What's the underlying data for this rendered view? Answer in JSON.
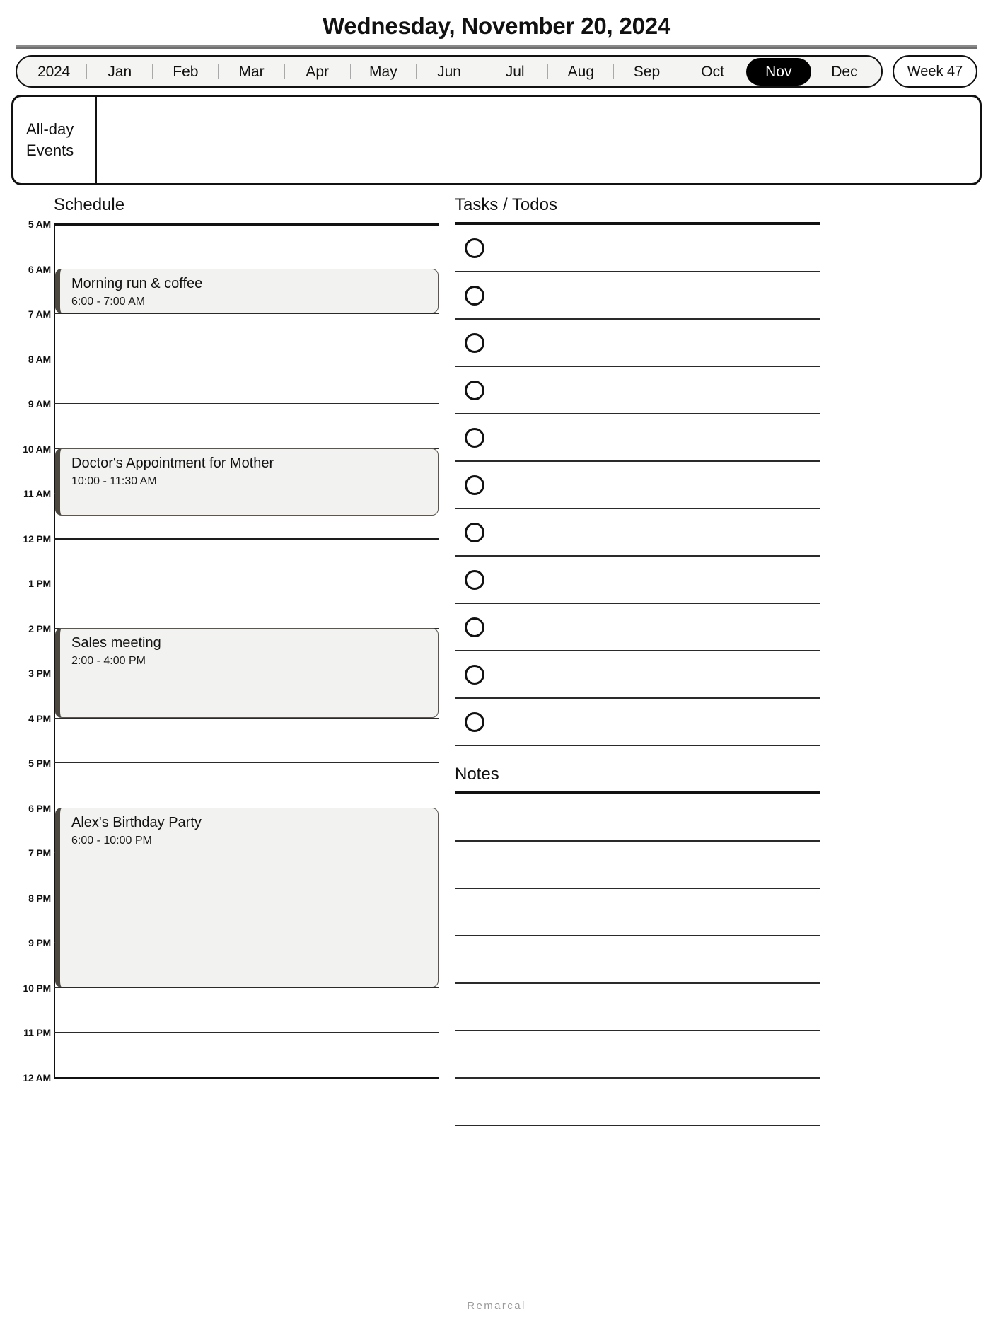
{
  "header": {
    "title": "Wednesday, November 20, 2024"
  },
  "monthbar": {
    "year": "2024",
    "months": [
      "Jan",
      "Feb",
      "Mar",
      "Apr",
      "May",
      "Jun",
      "Jul",
      "Aug",
      "Sep",
      "Oct",
      "Nov",
      "Dec"
    ],
    "active_month": "Nov",
    "week_label": "Week 47"
  },
  "allday": {
    "label": "All-day\nEvents",
    "label_line1": "All-day",
    "label_line2": "Events",
    "events": []
  },
  "schedule": {
    "heading": "Schedule",
    "start_hour": "5 AM",
    "end_hour": "12 AM",
    "hour_labels": [
      "5 AM",
      "6 AM",
      "7 AM",
      "8 AM",
      "9 AM",
      "10 AM",
      "11 AM",
      "12 PM",
      "1 PM",
      "2 PM",
      "3 PM",
      "4 PM",
      "5 PM",
      "6 PM",
      "7 PM",
      "8 PM",
      "9 PM",
      "10 PM",
      "11 PM",
      "12 AM"
    ],
    "events": [
      {
        "title": "Morning run & coffee",
        "time": "6:00 - 7:00 AM",
        "start": 6.0,
        "end": 7.0
      },
      {
        "title": "Doctor's Appointment for Mother",
        "time": "10:00 - 11:30 AM",
        "start": 10.0,
        "end": 11.5
      },
      {
        "title": "Sales meeting",
        "time": "2:00 - 4:00 PM",
        "start": 14.0,
        "end": 16.0
      },
      {
        "title": "Alex's Birthday Party",
        "time": "6:00 - 10:00 PM",
        "start": 18.0,
        "end": 22.0
      }
    ]
  },
  "tasks": {
    "heading": "Tasks / Todos",
    "items": [
      "",
      "",
      "",
      "",
      "",
      "",
      "",
      "",
      "",
      "",
      ""
    ]
  },
  "notes": {
    "heading": "Notes",
    "lines": [
      "",
      "",
      "",
      "",
      "",
      "",
      ""
    ]
  },
  "footer": {
    "brand": "Remarcal"
  },
  "colors": {
    "accent_active": "#000000",
    "event_fill": "#f2f2f0",
    "event_accent": "#4c473f",
    "pill_fill": "#f4f4f2",
    "rule": "#111111",
    "footer_text": "#9b9b9b"
  }
}
